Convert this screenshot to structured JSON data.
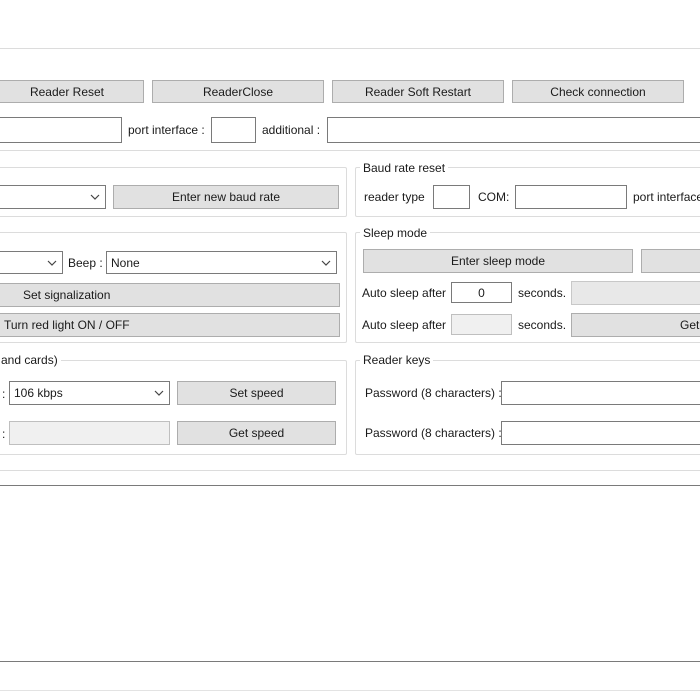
{
  "toolbar": {
    "reader_reset": "Reader Reset",
    "reader_close": "ReaderClose",
    "reader_soft_restart": "Reader Soft Restart",
    "check_connection": "Check connection"
  },
  "connection": {
    "port_interface_label": "port interface :",
    "additional_label": "additional :",
    "port_value": "",
    "port_interface_value": "",
    "additional_value": ""
  },
  "baud_left": {
    "select_value": "",
    "enter_button": "Enter new baud rate"
  },
  "baud_reset": {
    "title": "Baud rate reset",
    "reader_type_label": "reader type",
    "com_label": "COM:",
    "port_interface_label": "port interface"
  },
  "signal": {
    "light_value": "",
    "beep_label": "Beep :",
    "beep_value": "None",
    "set_button": "Set signalization",
    "red_light_button": "Turn red light ON / OFF"
  },
  "sleep": {
    "title": "Sleep mode",
    "enter_button": "Enter sleep mode",
    "auto_sleep_label_1": "Auto sleep after",
    "auto_sleep_value_1": "0",
    "seconds_label_1": "seconds.",
    "auto_sleep_label_2": "Auto sleep after",
    "auto_sleep_value_2": "",
    "seconds_label_2": "seconds.",
    "get_button": "Get"
  },
  "speed": {
    "title": "and cards)",
    "colon_1": ":",
    "speed_value": "106 kbps",
    "set_button": "Set speed",
    "colon_2": ":",
    "get_value": "",
    "get_button": "Get speed"
  },
  "keys": {
    "title": "Reader keys",
    "password_label_1": "Password (8 characters) :",
    "password_label_2": "Password (8 characters) :"
  },
  "log": {
    "text": ""
  },
  "icons": {
    "dropdown": "chevron-down-icon"
  }
}
